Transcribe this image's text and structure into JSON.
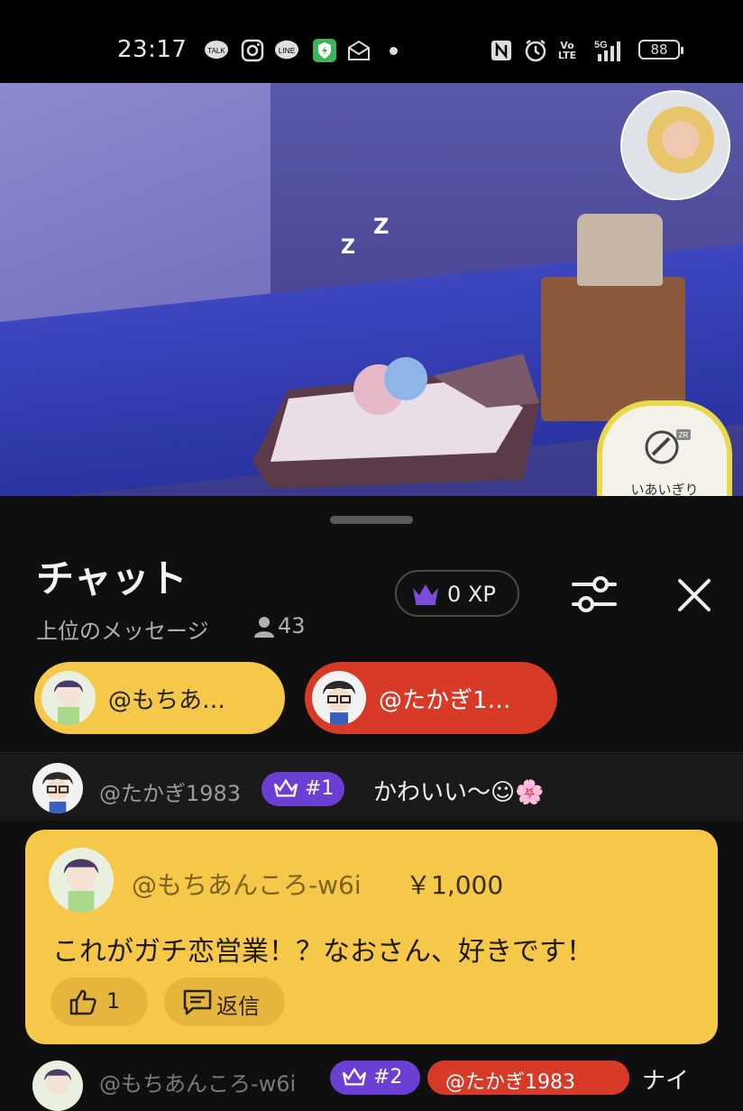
{
  "status_bar": {
    "time": "23:17",
    "icons": [
      "talk-icon",
      "instagram-icon",
      "line-icon",
      "vpn-shield-icon",
      "mail-icon",
      "nfc-icon",
      "alarm-icon",
      "volte-icon",
      "5g-signal-icon"
    ],
    "talk_label": "TALK",
    "line_label": "LINE",
    "volte_label": "Vo\nLTE",
    "net_label": "5G",
    "battery": "88"
  },
  "video": {
    "game_widget_label": "いあいぎり",
    "game_widget_badge": "ZR",
    "zz": [
      "Z",
      "Z"
    ]
  },
  "chat": {
    "title": "チャット",
    "subtitle": "上位のメッセージ",
    "viewer_count": "43",
    "xp_label": "0 XP",
    "pinned": [
      {
        "label": "@もちあ…",
        "color": "#f6c84a"
      },
      {
        "label": "@たかぎ1…",
        "color": "#d83a28"
      }
    ],
    "messages": [
      {
        "author": "@たかぎ1983",
        "rank": "#1",
        "text": "かわいい〜☺🌸"
      }
    ],
    "super_chat": {
      "author": "@もちあんころ-w6i",
      "amount": "￥1,000",
      "text": "これがガチ恋営業！？なおさん、好きです！",
      "like_count": "1",
      "reply_label": "返信"
    },
    "next_message": {
      "author": "@もちあんころ-w6i",
      "rank": "#2",
      "mention": "@たかぎ1983",
      "tail": "ナイ"
    }
  },
  "colors": {
    "accent_purple": "#6b3fd4",
    "super_yellow": "#f6c84a",
    "mention_red": "#d83a28"
  }
}
